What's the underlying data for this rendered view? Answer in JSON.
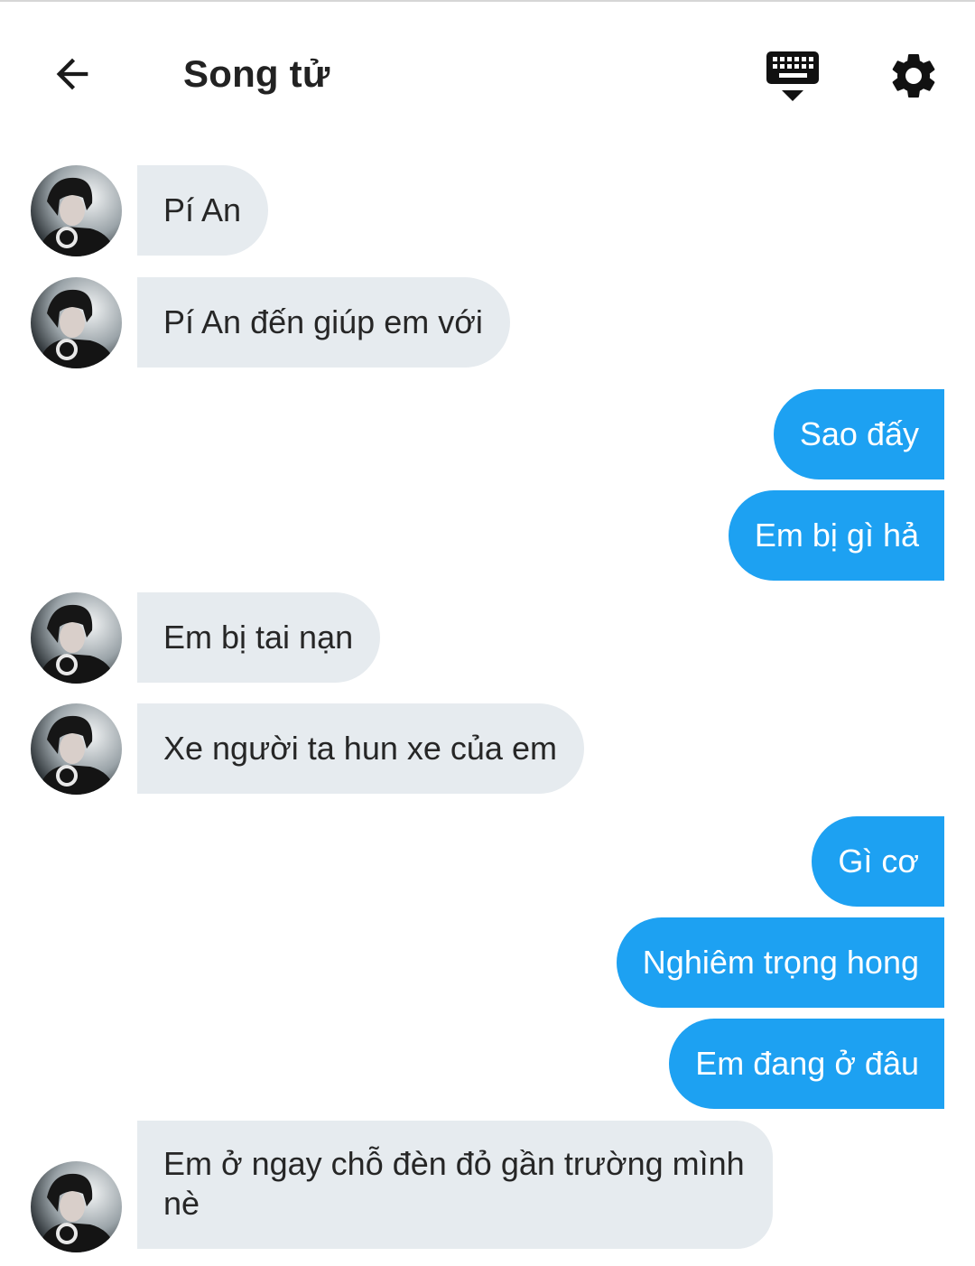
{
  "header": {
    "title": "Song tử"
  },
  "messages": [
    {
      "side": "in",
      "text": "Pí An"
    },
    {
      "side": "in",
      "text": "Pí An đến giúp em với"
    },
    {
      "side": "out",
      "text": "Sao đấy"
    },
    {
      "side": "out",
      "text": "Em bị gì hả"
    },
    {
      "side": "in",
      "text": "Em bị tai nạn"
    },
    {
      "side": "in",
      "text": "Xe người ta hun xe của em"
    },
    {
      "side": "out",
      "text": "Gì cơ"
    },
    {
      "side": "out",
      "text": "Nghiêm trọng hong"
    },
    {
      "side": "out",
      "text": "Em đang ở đâu"
    },
    {
      "side": "in",
      "text": "Em ở ngay chỗ đèn đỏ gần trường mình nè"
    }
  ],
  "icons": {
    "back": "arrow-left-icon",
    "keyboard": "keyboard-hide-icon",
    "settings": "gear-icon",
    "avatar": "avatar-photo"
  },
  "colors": {
    "outgoing_bubble": "#1da1f2",
    "incoming_bubble": "#e6ebef",
    "text": "#222222"
  }
}
